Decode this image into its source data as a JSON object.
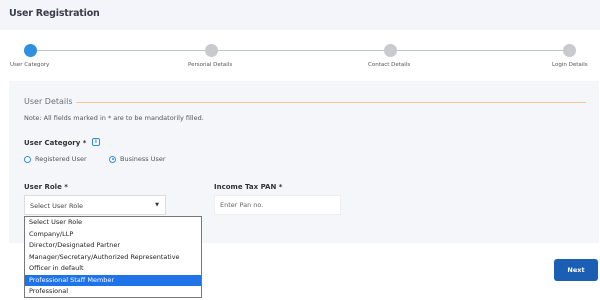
{
  "header": {
    "title": "User Registration"
  },
  "stepper": {
    "steps": [
      {
        "label": "User Category",
        "active": true
      },
      {
        "label": "Personal Details",
        "active": false
      },
      {
        "label": "Contact Details",
        "active": false
      },
      {
        "label": "Login Details",
        "active": false
      }
    ],
    "active_color": "#2f8fe0",
    "inactive_color": "#c9cacd"
  },
  "form": {
    "section_title": "User Details",
    "note": "Note: All fields marked in * are to be mandatorily filled.",
    "user_category": {
      "label": "User Category *",
      "info_icon": "info-icon",
      "options": [
        {
          "label": "Registered User",
          "checked": false
        },
        {
          "label": "Business User",
          "checked": true
        }
      ]
    },
    "user_role": {
      "label": "User Role *",
      "selected": "Select User Role",
      "options": [
        "Select User Role",
        "Company/LLP",
        "Director/Designated Partner",
        "Manager/Secretary/Authorized Representative",
        "Officer in default",
        "Professional Staff Member",
        "Professional"
      ],
      "highlighted": "Professional Staff Member"
    },
    "pan": {
      "label": "Income Tax PAN *",
      "placeholder": "Enter Pan no."
    }
  },
  "actions": {
    "next_label": "Next"
  }
}
